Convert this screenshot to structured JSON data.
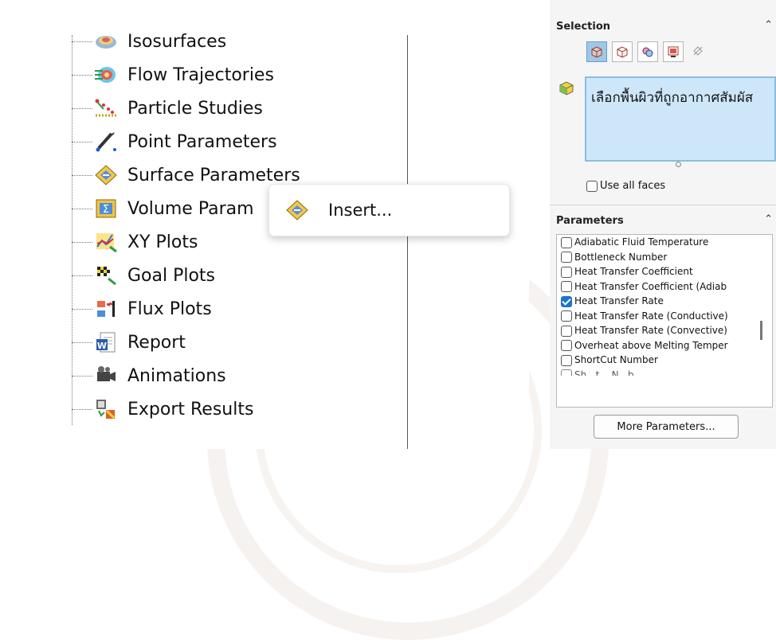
{
  "tree": {
    "items": [
      {
        "label": "Isosurfaces",
        "icon": "isosurfaces-icon"
      },
      {
        "label": "Flow Trajectories",
        "icon": "flow-trajectories-icon"
      },
      {
        "label": "Particle Studies",
        "icon": "particle-studies-icon"
      },
      {
        "label": "Point Parameters",
        "icon": "point-parameters-icon"
      },
      {
        "label": "Surface Parameters",
        "icon": "surface-parameters-icon"
      },
      {
        "label": "Volume Param",
        "icon": "volume-parameters-icon"
      },
      {
        "label": "XY Plots",
        "icon": "xy-plots-icon"
      },
      {
        "label": "Goal Plots",
        "icon": "goal-plots-icon"
      },
      {
        "label": "Flux Plots",
        "icon": "flux-plots-icon"
      },
      {
        "label": "Report",
        "icon": "report-icon"
      },
      {
        "label": "Animations",
        "icon": "animations-icon"
      },
      {
        "label": "Export Results",
        "icon": "export-results-icon"
      }
    ]
  },
  "context_menu": {
    "items": [
      {
        "label": "Insert...",
        "icon": "surface-parameters-icon"
      }
    ]
  },
  "property_manager": {
    "selection": {
      "title": "Selection",
      "filters": [
        "face-filter-icon",
        "body-filter-icon",
        "component-filter-icon",
        "solid-filter-icon",
        "clear-filter-icon"
      ],
      "selected_text": "เลือกพื้นผิวที่ถูกอากาศสัมผัส",
      "use_all_faces_label": "Use all faces",
      "use_all_faces_checked": false
    },
    "parameters": {
      "title": "Parameters",
      "items": [
        {
          "label": "Adiabatic Fluid Temperature",
          "checked": false
        },
        {
          "label": "Bottleneck Number",
          "checked": false
        },
        {
          "label": "Heat Transfer Coefficient",
          "checked": false
        },
        {
          "label": "Heat Transfer Coefficient (Adiab",
          "checked": false
        },
        {
          "label": "Heat Transfer Rate",
          "checked": true
        },
        {
          "label": "Heat Transfer Rate (Conductive)",
          "checked": false
        },
        {
          "label": "Heat Transfer Rate (Convective)",
          "checked": false
        },
        {
          "label": "Overheat above Melting Temper",
          "checked": false
        },
        {
          "label": "ShortCut Number",
          "checked": false
        },
        {
          "label": "Sh...t... N...b...",
          "checked": false
        }
      ],
      "more_button_label": "More Parameters..."
    }
  },
  "colors": {
    "selection_box": "#cde7f9",
    "check_accent": "#1e73d2"
  }
}
